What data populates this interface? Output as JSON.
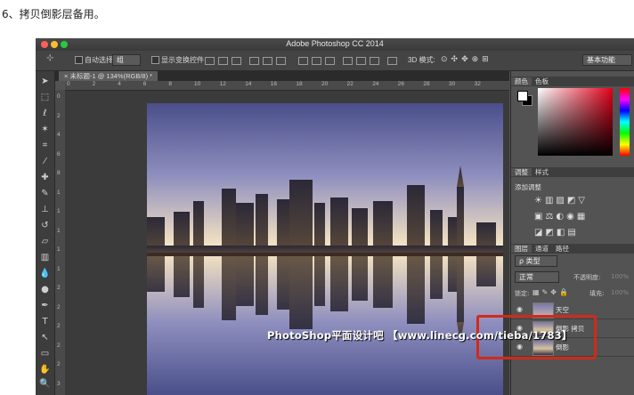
{
  "caption": "6、拷贝倒影层备用。",
  "window": {
    "title": "Adobe Photoshop CC 2014"
  },
  "options_bar": {
    "auto_select_label": "自动选择:",
    "auto_select_value": "组",
    "show_transform_label": "显示变换控件",
    "mode_3d_label": "3D 模式:",
    "workspace_value": "基本功能"
  },
  "document": {
    "tab_label": "未标题-1 @ 134%(RGB/8) *"
  },
  "ruler": {
    "h_ticks": [
      "0",
      "2",
      "4",
      "6",
      "8",
      "10",
      "12",
      "14",
      "16",
      "18",
      "20",
      "22",
      "24",
      "26",
      "28",
      "30",
      "32"
    ],
    "v_ticks": [
      "0",
      "2",
      "4",
      "6",
      "8",
      "1",
      "1",
      "1",
      "1",
      "1",
      "2",
      "2",
      "2",
      "2",
      "2",
      "3"
    ]
  },
  "panels": {
    "color_tabs": [
      "颜色",
      "色板"
    ],
    "adjust_tabs": [
      "调整",
      "样式"
    ],
    "add_adjustment": "添加调整",
    "layers_tabs": [
      "图层",
      "通道",
      "路径"
    ],
    "kind_filter": "ρ 类型",
    "blend_mode": "正常",
    "opacity_label": "不透明度:",
    "opacity_value": "100%",
    "lock_label": "锁定:",
    "fill_label": "填充:",
    "fill_value": "100%"
  },
  "layers": [
    {
      "name": "天空"
    },
    {
      "name": "倒影 拷贝"
    },
    {
      "name": "倒影"
    }
  ],
  "watermark": "PhotoShop平面设计吧 【www.linecg.com/tieba/1783】",
  "colors": {
    "highlight": "#d22a18",
    "ps_bg": "#535353"
  }
}
